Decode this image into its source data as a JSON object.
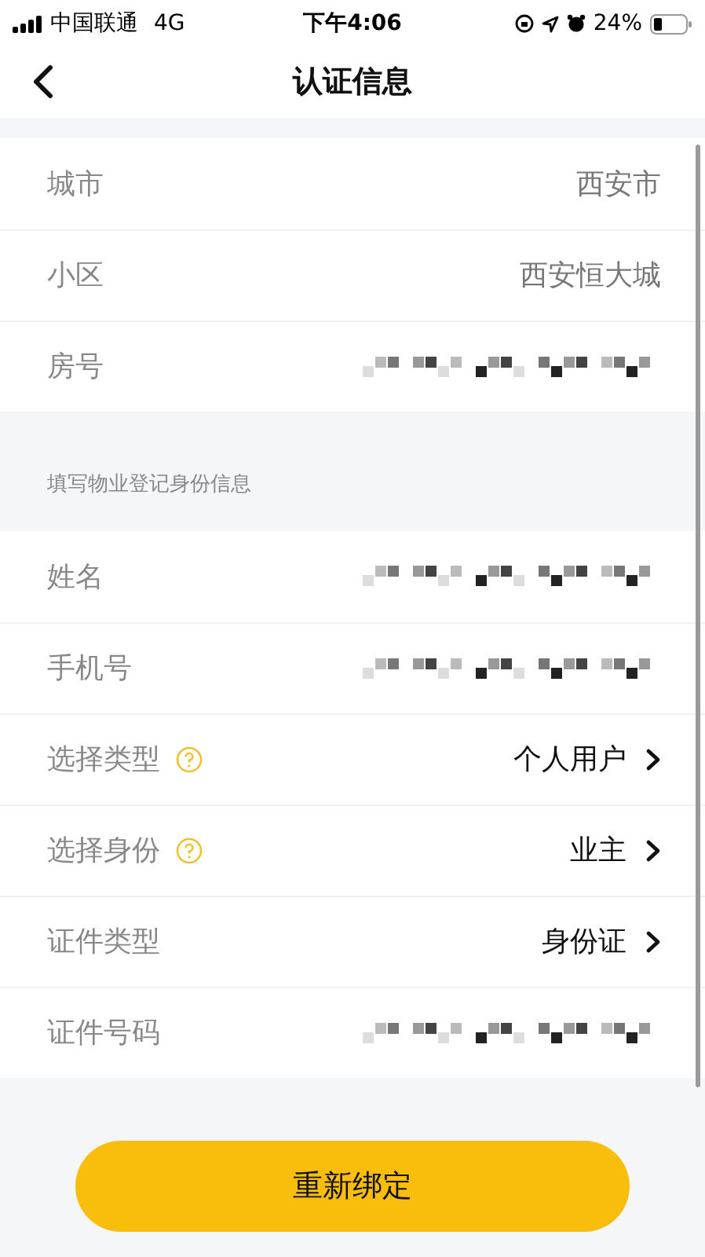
{
  "status_bar": {
    "carrier": "中国联通",
    "network": "4G",
    "time": "下午4:06",
    "battery_text": "24%"
  },
  "nav": {
    "title": "认证信息"
  },
  "sections": [
    {
      "rows": [
        {
          "kind": "text",
          "label": "城市",
          "value": "西安市",
          "help": false
        },
        {
          "kind": "text",
          "label": "小区",
          "value": "西安恒大城",
          "help": false
        },
        {
          "kind": "redacted",
          "label": "房号",
          "help": false
        }
      ]
    },
    {
      "header": "填写物业登记身份信息",
      "rows": [
        {
          "kind": "redacted",
          "label": "姓名",
          "help": false
        },
        {
          "kind": "redacted",
          "label": "手机号",
          "help": false
        },
        {
          "kind": "select",
          "label": "选择类型",
          "value": "个人用户",
          "help": true
        },
        {
          "kind": "select",
          "label": "选择身份",
          "value": "业主",
          "help": true
        },
        {
          "kind": "select",
          "label": "证件类型",
          "value": "身份证",
          "help": false
        },
        {
          "kind": "redacted",
          "label": "证件号码",
          "help": false
        }
      ]
    }
  ],
  "button": {
    "label": "重新绑定"
  }
}
